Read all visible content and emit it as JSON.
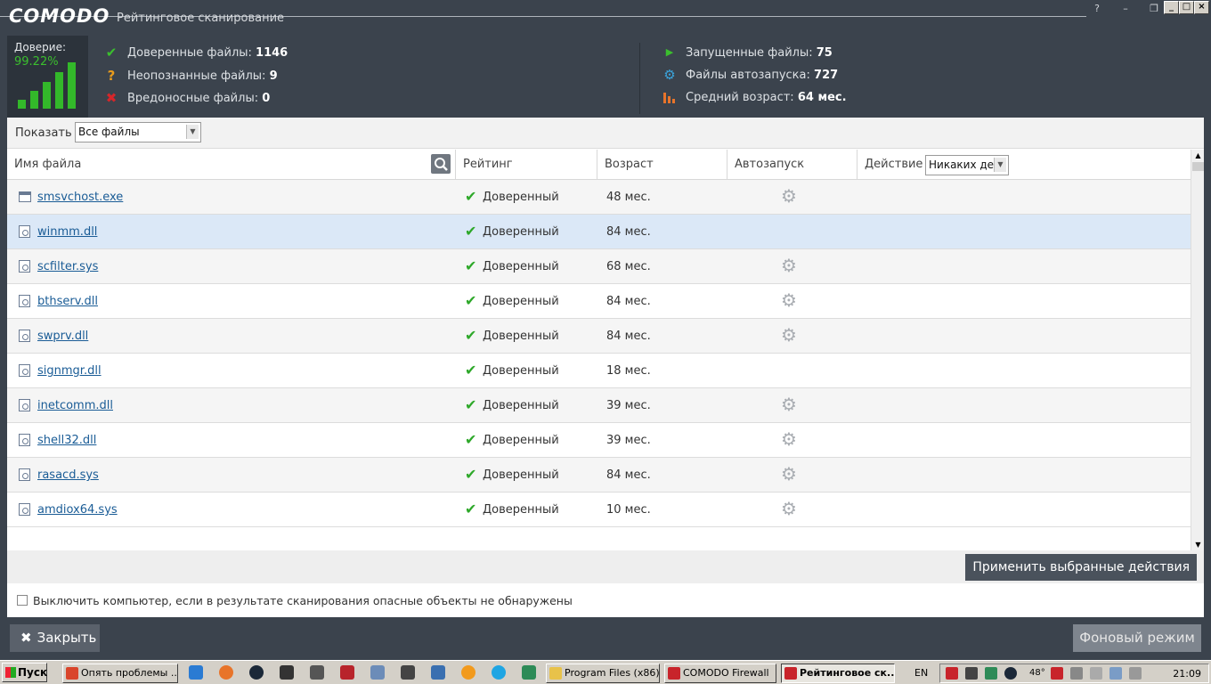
{
  "app": {
    "logo": "COMODO",
    "window_title": "Рейтинговое сканирование",
    "help_label": "?",
    "minimize_label": "–",
    "restore_label": "❐",
    "close_label": "✕"
  },
  "stats": {
    "trust_label": "Доверие:",
    "trust_value": "99.22%",
    "trusted_label": "Доверенные файлы:",
    "trusted_count": "1146",
    "unknown_label": "Неопознанные файлы:",
    "unknown_count": "9",
    "malicious_label": "Вредоносные файлы:",
    "malicious_count": "0",
    "running_label": "Запущенные файлы:",
    "running_count": "75",
    "autorun_label": "Файлы автозапуска:",
    "autorun_count": "727",
    "avg_age_label": "Средний возраст:",
    "avg_age_value": "64 мес."
  },
  "filter": {
    "show_label": "Показать",
    "show_value": "Все файлы"
  },
  "table": {
    "columns": {
      "filename": "Имя файла",
      "rating": "Рейтинг",
      "age": "Возраст",
      "autorun": "Автозапуск",
      "action": "Действие"
    },
    "action_select_value": "Никаких дей",
    "rows": [
      {
        "name": "smsvchost.exe",
        "type": "exe",
        "rating": "Доверенный",
        "age": "48 мес.",
        "autorun": true
      },
      {
        "name": "winmm.dll",
        "type": "dll",
        "rating": "Доверенный",
        "age": "84 мес.",
        "autorun": false
      },
      {
        "name": "scfilter.sys",
        "type": "dll",
        "rating": "Доверенный",
        "age": "68 мес.",
        "autorun": true
      },
      {
        "name": "bthserv.dll",
        "type": "dll",
        "rating": "Доверенный",
        "age": "84 мес.",
        "autorun": true
      },
      {
        "name": "swprv.dll",
        "type": "dll",
        "rating": "Доверенный",
        "age": "84 мес.",
        "autorun": true
      },
      {
        "name": "signmgr.dll",
        "type": "dll",
        "rating": "Доверенный",
        "age": "18 мес.",
        "autorun": false
      },
      {
        "name": "inetcomm.dll",
        "type": "dll",
        "rating": "Доверенный",
        "age": "39 мес.",
        "autorun": true
      },
      {
        "name": "shell32.dll",
        "type": "dll",
        "rating": "Доверенный",
        "age": "39 мес.",
        "autorun": true
      },
      {
        "name": "rasacd.sys",
        "type": "dll",
        "rating": "Доверенный",
        "age": "84 мес.",
        "autorun": true
      },
      {
        "name": "amdiox64.sys",
        "type": "dll",
        "rating": "Доверенный",
        "age": "10 мес.",
        "autorun": true
      }
    ]
  },
  "actions": {
    "apply_label": "Применить выбранные действия",
    "shutdown_label": "Выключить компьютер, если в результате сканирования опасные объекты не обнаружены",
    "close_label": "Закрыть",
    "background_label": "Фоновый режим"
  },
  "taskbar": {
    "start_label": "Пуск",
    "tasks": [
      {
        "label": "Опять проблемы ...",
        "icon": "chrome-icon",
        "color": "#d9452b"
      },
      {
        "label": "Program Files (x86)",
        "icon": "folder-icon",
        "color": "#e8c24a"
      },
      {
        "label": "COMODO Firewall",
        "icon": "comodo-icon",
        "color": "#c8242b"
      },
      {
        "label": "Рейтинговое ск...",
        "icon": "comodo-icon",
        "color": "#c8242b"
      }
    ],
    "language": "EN",
    "temperature": "48°",
    "clock": "21:09"
  },
  "colors": {
    "accent_green": "#3bbf2e",
    "link_blue": "#1a5c96",
    "selected_row": "#dbe8f7",
    "header_bg": "#3b434d"
  }
}
